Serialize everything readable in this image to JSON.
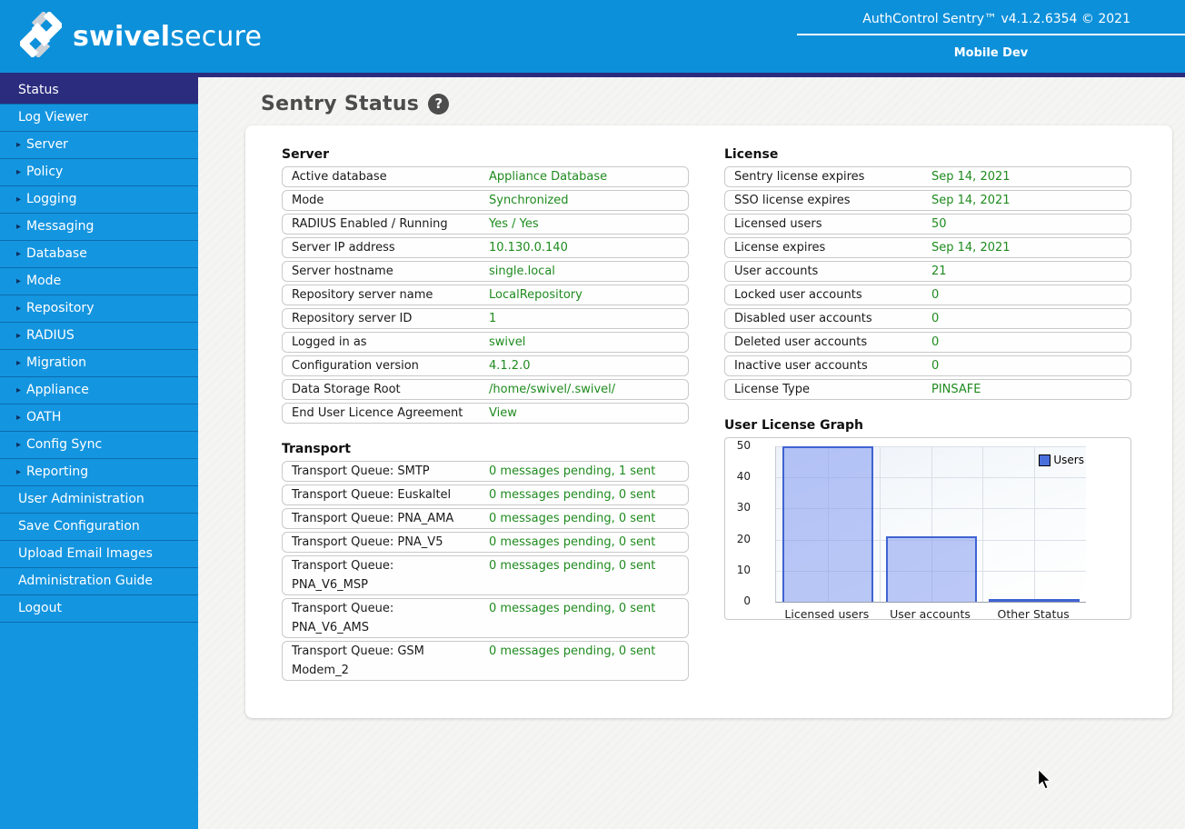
{
  "header": {
    "logo": {
      "primary": "swivel",
      "secondary": "secure",
      "icon": "swivel-diamond-logo"
    },
    "version_text": "AuthControl Sentry™ v4.1.2.6354 © 2021",
    "environment_label": "Mobile Dev"
  },
  "sidebar": {
    "items": [
      {
        "label": "Status",
        "active": true,
        "expandable": false
      },
      {
        "label": "Log Viewer",
        "active": false,
        "expandable": false
      },
      {
        "label": "Server",
        "active": false,
        "expandable": true
      },
      {
        "label": "Policy",
        "active": false,
        "expandable": true
      },
      {
        "label": "Logging",
        "active": false,
        "expandable": true
      },
      {
        "label": "Messaging",
        "active": false,
        "expandable": true
      },
      {
        "label": "Database",
        "active": false,
        "expandable": true
      },
      {
        "label": "Mode",
        "active": false,
        "expandable": true
      },
      {
        "label": "Repository",
        "active": false,
        "expandable": true
      },
      {
        "label": "RADIUS",
        "active": false,
        "expandable": true
      },
      {
        "label": "Migration",
        "active": false,
        "expandable": true
      },
      {
        "label": "Appliance",
        "active": false,
        "expandable": true
      },
      {
        "label": "OATH",
        "active": false,
        "expandable": true
      },
      {
        "label": "Config Sync",
        "active": false,
        "expandable": true
      },
      {
        "label": "Reporting",
        "active": false,
        "expandable": true
      },
      {
        "label": "User Administration",
        "active": false,
        "expandable": false
      },
      {
        "label": "Save Configuration",
        "active": false,
        "expandable": false
      },
      {
        "label": "Upload Email Images",
        "active": false,
        "expandable": false
      },
      {
        "label": "Administration Guide",
        "active": false,
        "expandable": false
      },
      {
        "label": "Logout",
        "active": false,
        "expandable": false
      }
    ]
  },
  "main": {
    "title": "Sentry Status",
    "help_icon": "?",
    "server_section": {
      "heading": "Server",
      "rows": [
        {
          "label": "Active database",
          "value": "Appliance Database"
        },
        {
          "label": "Mode",
          "value": "Synchronized"
        },
        {
          "label": "RADIUS Enabled / Running",
          "value": "Yes / Yes"
        },
        {
          "label": "Server IP address",
          "value": "10.130.0.140"
        },
        {
          "label": "Server hostname",
          "value": "single.local"
        },
        {
          "label": "Repository server name",
          "value": "LocalRepository"
        },
        {
          "label": "Repository server ID",
          "value": "1"
        },
        {
          "label": "Logged in as",
          "value": "swivel"
        },
        {
          "label": "Configuration version",
          "value": "4.1.2.0"
        },
        {
          "label": "Data Storage Root",
          "value": "/home/swivel/.swivel/"
        },
        {
          "label": "End User Licence Agreement",
          "value": "View",
          "value_is_link": true
        }
      ]
    },
    "transport_section": {
      "heading": "Transport",
      "rows": [
        {
          "label": "Transport Queue: SMTP",
          "value": "0 messages pending, 1 sent"
        },
        {
          "label": "Transport Queue: Euskaltel",
          "value": "0 messages pending, 0 sent"
        },
        {
          "label": "Transport Queue: PNA_AMA",
          "value": "0 messages pending, 0 sent"
        },
        {
          "label": "Transport Queue: PNA_V5",
          "value": "0 messages pending, 0 sent"
        },
        {
          "label": "Transport Queue:",
          "label_line2": "PNA_V6_MSP",
          "value": "0 messages pending, 0 sent"
        },
        {
          "label": "Transport Queue:",
          "label_line2": "PNA_V6_AMS",
          "value": "0 messages pending, 0 sent"
        },
        {
          "label": "Transport Queue: GSM",
          "label_line2": "Modem_2",
          "value": "0 messages pending, 0 sent"
        }
      ]
    },
    "license_section": {
      "heading": "License",
      "rows": [
        {
          "label": "Sentry license expires",
          "value": "Sep 14, 2021"
        },
        {
          "label": "SSO license expires",
          "value": "Sep 14, 2021"
        },
        {
          "label": "Licensed users",
          "value": "50"
        },
        {
          "label": "License expires",
          "value": "Sep 14, 2021"
        },
        {
          "label": "User accounts",
          "value": "21"
        },
        {
          "label": "Locked user accounts",
          "label_is_link": true,
          "value": "0"
        },
        {
          "label": "Disabled user accounts",
          "label_is_link": true,
          "value": "0"
        },
        {
          "label": "Deleted user accounts",
          "label_is_link": true,
          "value": "0"
        },
        {
          "label": "Inactive user accounts",
          "label_is_link": true,
          "value": "0"
        },
        {
          "label": "License Type",
          "value": "PINSAFE"
        }
      ]
    },
    "graph_section": {
      "heading": "User License Graph"
    }
  },
  "chart_data": {
    "type": "bar",
    "title": "User License Graph",
    "categories": [
      "Licensed users",
      "User accounts",
      "Other Status"
    ],
    "series": [
      {
        "name": "Users",
        "values": [
          50,
          21,
          0
        ]
      }
    ],
    "ylim": [
      0,
      50
    ],
    "yticks": [
      0,
      10,
      20,
      30,
      40,
      50
    ],
    "xlabel": "",
    "ylabel": "",
    "grid": true,
    "legend_position": "top-right",
    "bar_fill": "#a9bdf2",
    "bar_border": "#3f63d2"
  },
  "colors": {
    "header_blue": "#0d90da",
    "sidebar_blue": "#1495e0",
    "active_navy": "#2b2c7e",
    "value_green": "#1f8b1f",
    "link_blue": "#1d76d2",
    "title_gray": "#4c4c4c"
  }
}
